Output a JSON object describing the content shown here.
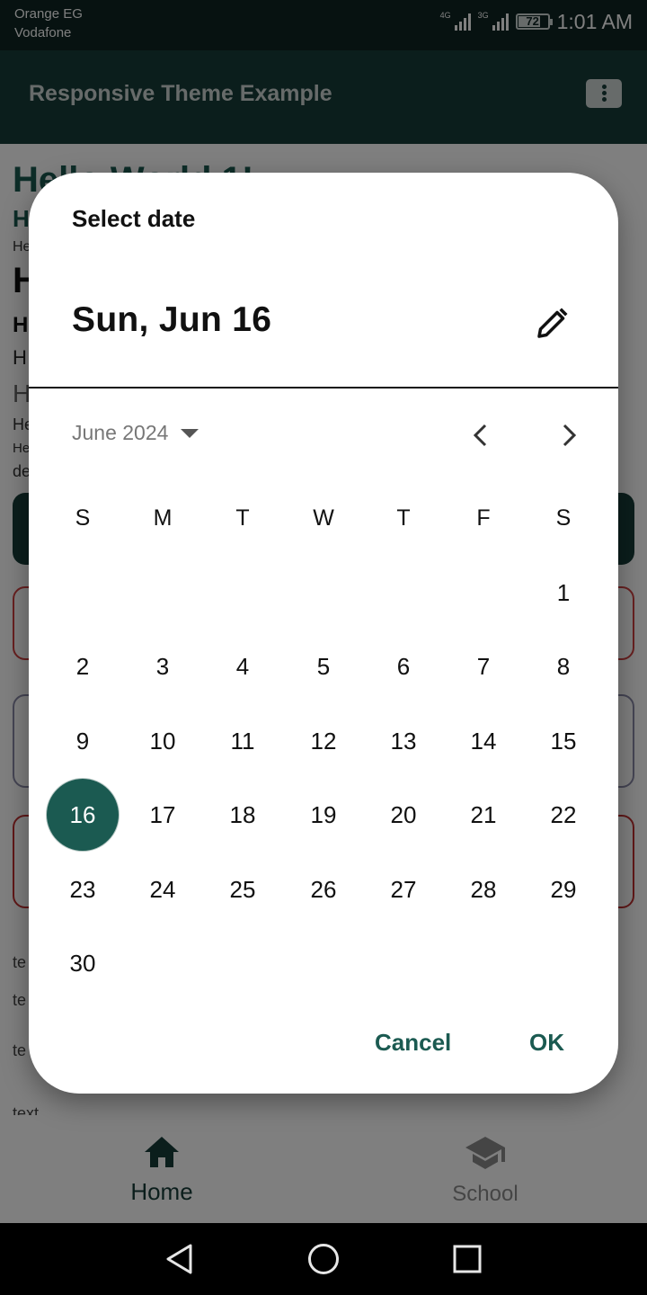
{
  "status_bar": {
    "carrier_1": "Orange EG",
    "carrier_2": "Vodafone",
    "network_1": "4G",
    "network_2": "3G",
    "battery": "72",
    "time": "1:01 AM"
  },
  "app_bar": {
    "title": "Responsive Theme Example",
    "action_icon": "ticket-icon"
  },
  "background_content": {
    "heading_1": "Hello World 1!",
    "heading_2": "H",
    "small_1": "He",
    "heading_3": "H",
    "heading_4": "H",
    "heading_5": "H",
    "heading_6": "H",
    "small_2": "He",
    "small_3": "He",
    "small_4": "de",
    "text_lines": [
      "te",
      "te",
      "te",
      "text"
    ]
  },
  "bottom_nav": {
    "items": [
      {
        "label": "Home",
        "icon": "home-icon",
        "active": true
      },
      {
        "label": "School",
        "icon": "school-icon",
        "active": false
      }
    ]
  },
  "date_picker": {
    "header_label": "Select date",
    "headline": "Sun, Jun 16",
    "month_label": "June 2024",
    "weekdays": [
      "S",
      "M",
      "T",
      "W",
      "T",
      "F",
      "S"
    ],
    "days": [
      "1",
      "2",
      "3",
      "4",
      "5",
      "6",
      "7",
      "8",
      "9",
      "10",
      "11",
      "12",
      "13",
      "14",
      "15",
      "16",
      "17",
      "18",
      "19",
      "20",
      "21",
      "22",
      "23",
      "24",
      "25",
      "26",
      "27",
      "28",
      "29",
      "30"
    ],
    "first_weekday_index": 6,
    "selected_day": "16",
    "cancel_label": "Cancel",
    "ok_label": "OK",
    "colors": {
      "accent": "#1b5a51",
      "app_bar": "#173d38",
      "status_bar": "#0e2523"
    }
  }
}
